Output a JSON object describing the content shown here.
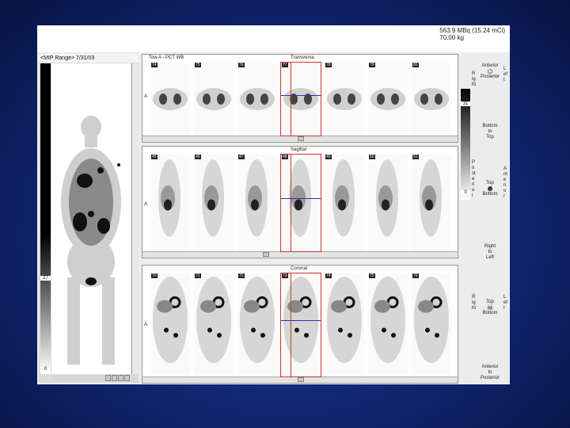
{
  "header": {
    "dose": "563.9 MBq (15.24 mCi)",
    "weight": "70.00 kg"
  },
  "mip": {
    "title": "<MIP Range> 7/31/03",
    "scale_mid": "27",
    "scale_min": "0",
    "corner": "1"
  },
  "transverse": {
    "title": "Tow A - PCT WB",
    "view": "Transverse",
    "axis": "A",
    "slices": [
      "74",
      "75",
      "76",
      "77",
      "78",
      "79",
      "80"
    ],
    "scale_top": "31",
    "scale_bottom": "0"
  },
  "sagittal": {
    "view": "Sagittal",
    "axis": "A",
    "slices": [
      "45",
      "46",
      "47",
      "48",
      "49",
      "50",
      "51"
    ]
  },
  "coronal": {
    "view": "Coronal",
    "axis": "A",
    "slices": [
      "70",
      "71",
      "72",
      "73",
      "74",
      "75",
      "76"
    ]
  },
  "orientation": {
    "transverse_left": "Right",
    "transverse_right": "Left",
    "anterior": "Anterior",
    "to": "to",
    "posterior": "Posterior",
    "bottom": "Bottom",
    "top": "Top",
    "sag_left": "Posterior",
    "sag_right": "Anterior",
    "cor_left": "Right",
    "cor_right": "Left",
    "right": "Right",
    "left": "Left"
  }
}
